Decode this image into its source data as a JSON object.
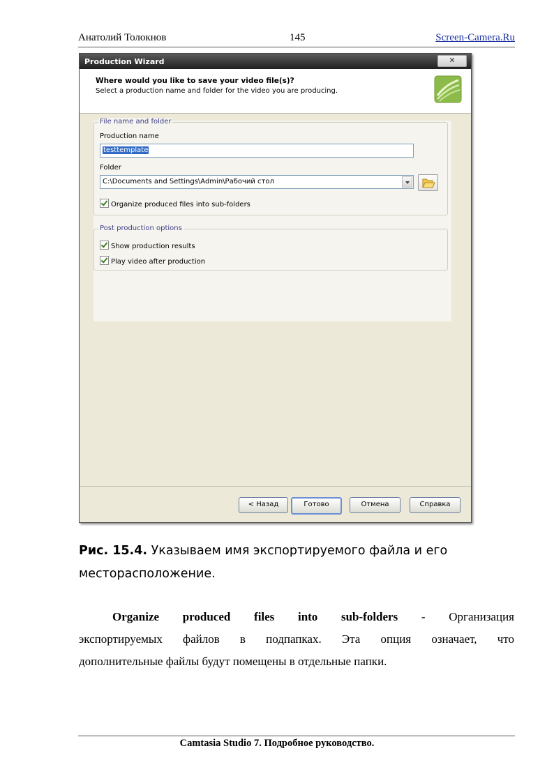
{
  "page_header": {
    "author": "Анатолий Толокнов",
    "page_number": "145",
    "site": "Screen-Camera.Ru"
  },
  "dialog": {
    "title": "Production Wizard",
    "close_glyph": "✕",
    "question": "Where would you like to save your video file(s)?",
    "description": "Select a production name and folder for the video you are producing.",
    "file_group": {
      "legend": "File name and folder",
      "production_name_label": "Production name",
      "production_name_value": "testtemplate",
      "folder_label": "Folder",
      "folder_value": "C:\\Documents and Settings\\Admin\\Рабочий стол",
      "organize_checkbox": "Organize produced files into sub-folders",
      "organize_checked": true
    },
    "post_group": {
      "legend": "Post production options",
      "show_results_checkbox": "Show production results",
      "show_results_checked": true,
      "play_video_checkbox": "Play video after production",
      "play_video_checked": true
    },
    "buttons": {
      "back": "< Назад",
      "finish": "Готово",
      "cancel": "Отмена",
      "help": "Справка"
    }
  },
  "caption": {
    "label": "Рис. 15.4.",
    "text": " Указываем имя экспортируемого файла и его месторасположение."
  },
  "body": {
    "term": "Organize produced files into sub-folders",
    "line1_rest": "- Организация",
    "line2": "экспортируемых файлов в подпапках. Эта опция означает, что",
    "line3": "дополнительные файлы будут помещены в отдельные папки."
  },
  "footer": "Camtasia Studio 7. Подробное руководство."
}
